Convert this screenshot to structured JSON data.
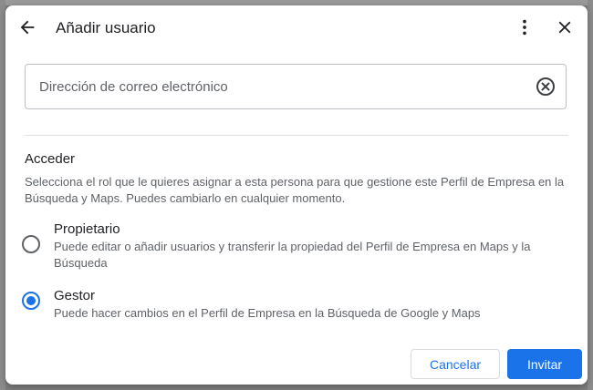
{
  "dialog": {
    "title": "Añadir usuario",
    "icons": {
      "back": "arrow-left-icon",
      "more": "more-vert-icon",
      "close": "close-icon",
      "clear": "clear-circle-icon"
    }
  },
  "email": {
    "placeholder": "Dirección de correo electrónico",
    "value": ""
  },
  "access": {
    "title": "Acceder",
    "description": "Selecciona el rol que le quieres asignar a esta persona para que gestione este Perfil de Empresa en la Búsqueda y Maps. Puedes cambiarlo en cualquier momento.",
    "options": [
      {
        "label": "Propietario",
        "description": "Puede editar o añadir usuarios y transferir la propiedad del Perfil de Empresa en Maps y la Búsqueda",
        "selected": false
      },
      {
        "label": "Gestor",
        "description": "Puede hacer cambios en el Perfil de Empresa en la Búsqueda de Google y Maps",
        "selected": true
      }
    ]
  },
  "actions": {
    "cancel_label": "Cancelar",
    "invite_label": "Invitar"
  },
  "colors": {
    "accent": "#1a73e8",
    "text_primary": "#202124",
    "text_secondary": "#5f6368"
  }
}
